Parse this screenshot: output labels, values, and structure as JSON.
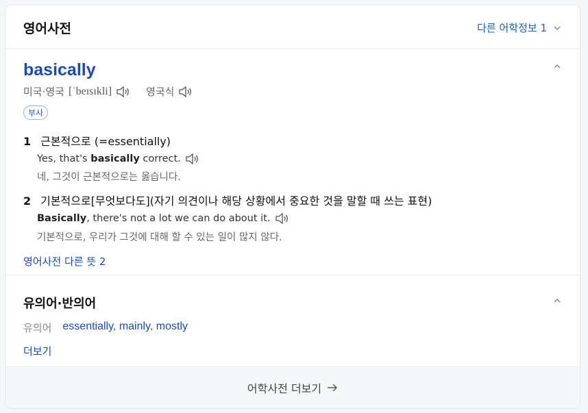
{
  "header": {
    "title": "영어사전",
    "other_info": "다른 어학정보 1"
  },
  "entry": {
    "word": "basically",
    "pron_region_1": "미국·영국",
    "pron_ipa": "[ˈbeɪsɪkli]",
    "pron_region_2": "영국식",
    "pos": "부사",
    "senses": [
      {
        "num": "1",
        "meaning": "근본적으로 (=essentially)",
        "example_pre": "Yes, that's ",
        "example_bold": "basically",
        "example_post": " correct.",
        "translation": "네, 그것이 근본적으로는 옳습니다."
      },
      {
        "num": "2",
        "meaning": "기본적으로[무엇보다도](자기 의견이나 해당 상황에서 중요한 것을 말할 때 쓰는 표현)",
        "example_pre": "",
        "example_bold": "Basically",
        "example_post": ", there's not a lot we can do about it.",
        "translation": "기본적으로, 우리가 그것에 대해 할 수 있는 일이 많지 않다."
      }
    ],
    "more_meanings": "영어사전 다른 뜻 2"
  },
  "synonyms": {
    "title": "유의어·반의어",
    "label": "유의어",
    "words": [
      "essentially,",
      "mainly,",
      "mostly"
    ],
    "see_more": "더보기"
  },
  "footer": {
    "label": "어학사전 더보기"
  },
  "colors": {
    "link": "#1d4ab0",
    "accent": "#1a5fb4"
  },
  "icons": [
    "chevron-down-icon",
    "chevron-up-icon",
    "speaker-icon",
    "arrow-right-icon"
  ]
}
